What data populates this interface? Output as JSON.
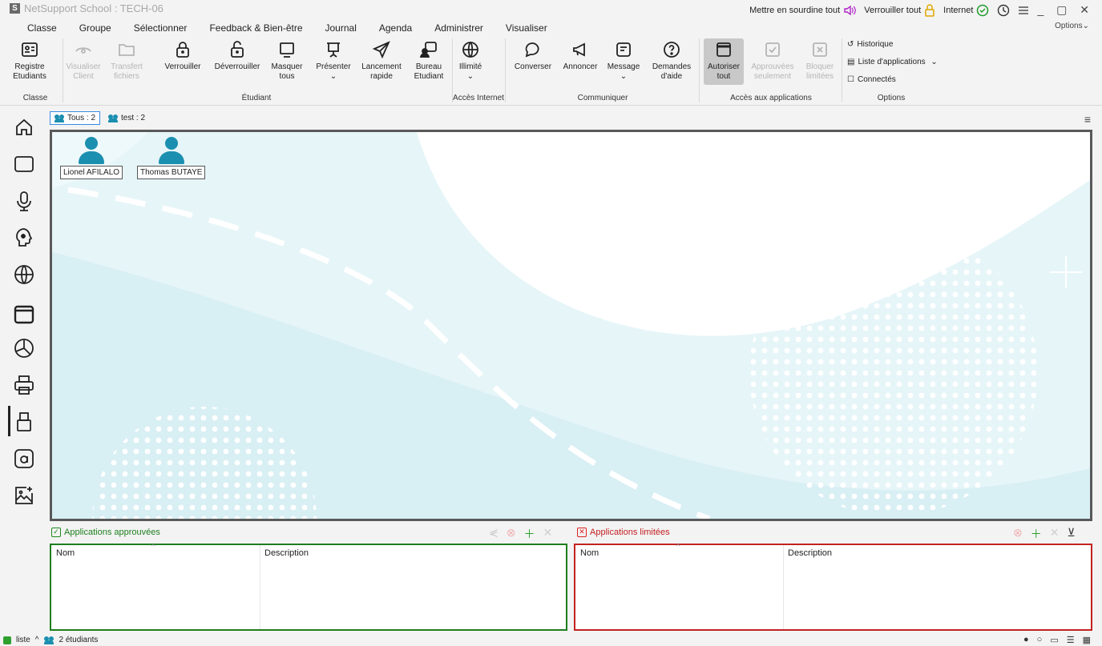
{
  "window": {
    "title": "NetSupport School : TECH-06",
    "app_icon": "S",
    "controls": "_ ▢ ✕",
    "options_label": "Options",
    "top_actions": {
      "mute_all": "Mettre en sourdine tout",
      "lock_all": "Verrouiller tout",
      "internet": "Internet"
    }
  },
  "menu": [
    "Classe",
    "Groupe",
    "Sélectionner",
    "Feedback & Bien-être",
    "Journal",
    "Agenda",
    "Administrer",
    "Visualiser"
  ],
  "ribbon": {
    "buttons": {
      "registre": "Registre Etudiants",
      "visualiser": "Visualiser Client",
      "transfert": "Transfert fichiers",
      "verrouiller": "Verrouiller",
      "deverrouiller": "Déverrouiller",
      "masquer": "Masquer tous",
      "presenter": "Présenter",
      "lancement": "Lancement rapide",
      "bureau": "Bureau Etudiant",
      "illimite": "Illimité",
      "converser": "Converser",
      "annoncer": "Annoncer",
      "message": "Message",
      "demandes": "Demandes d'aide",
      "autoriser": "Autoriser tout",
      "approuvees": "Approuvées seulement",
      "bloquer": "Bloquer limitées"
    },
    "options": {
      "historique": "Historique",
      "liste_apps": "Liste d'applications",
      "connectes": "Connectés"
    },
    "groups": {
      "classe": "Classe",
      "etudiant": "Étudiant",
      "acces_internet": "Accès Internet",
      "communiquer": "Communiquer",
      "acces_apps": "Accès aux applications",
      "options": "Options"
    }
  },
  "group_tabs": [
    {
      "label": "Tous : 2",
      "active": true
    },
    {
      "label": "test : 2",
      "active": false
    }
  ],
  "students": [
    {
      "name": "Lionel AFILALO"
    },
    {
      "name": "Thomas BUTAYE"
    }
  ],
  "panels": {
    "approved": {
      "title": "Applications approuvées",
      "col_name": "Nom",
      "col_desc": "Description"
    },
    "limited": {
      "title": "Applications limitées",
      "col_name": "Nom",
      "col_desc": "Description"
    }
  },
  "status": {
    "view_label": "liste",
    "students_count": "2 étudiants"
  },
  "colors": {
    "accent": "#2f7fd6",
    "student": "#1b8fb0",
    "approved": "#1e7e1e",
    "limited": "#c32121"
  }
}
